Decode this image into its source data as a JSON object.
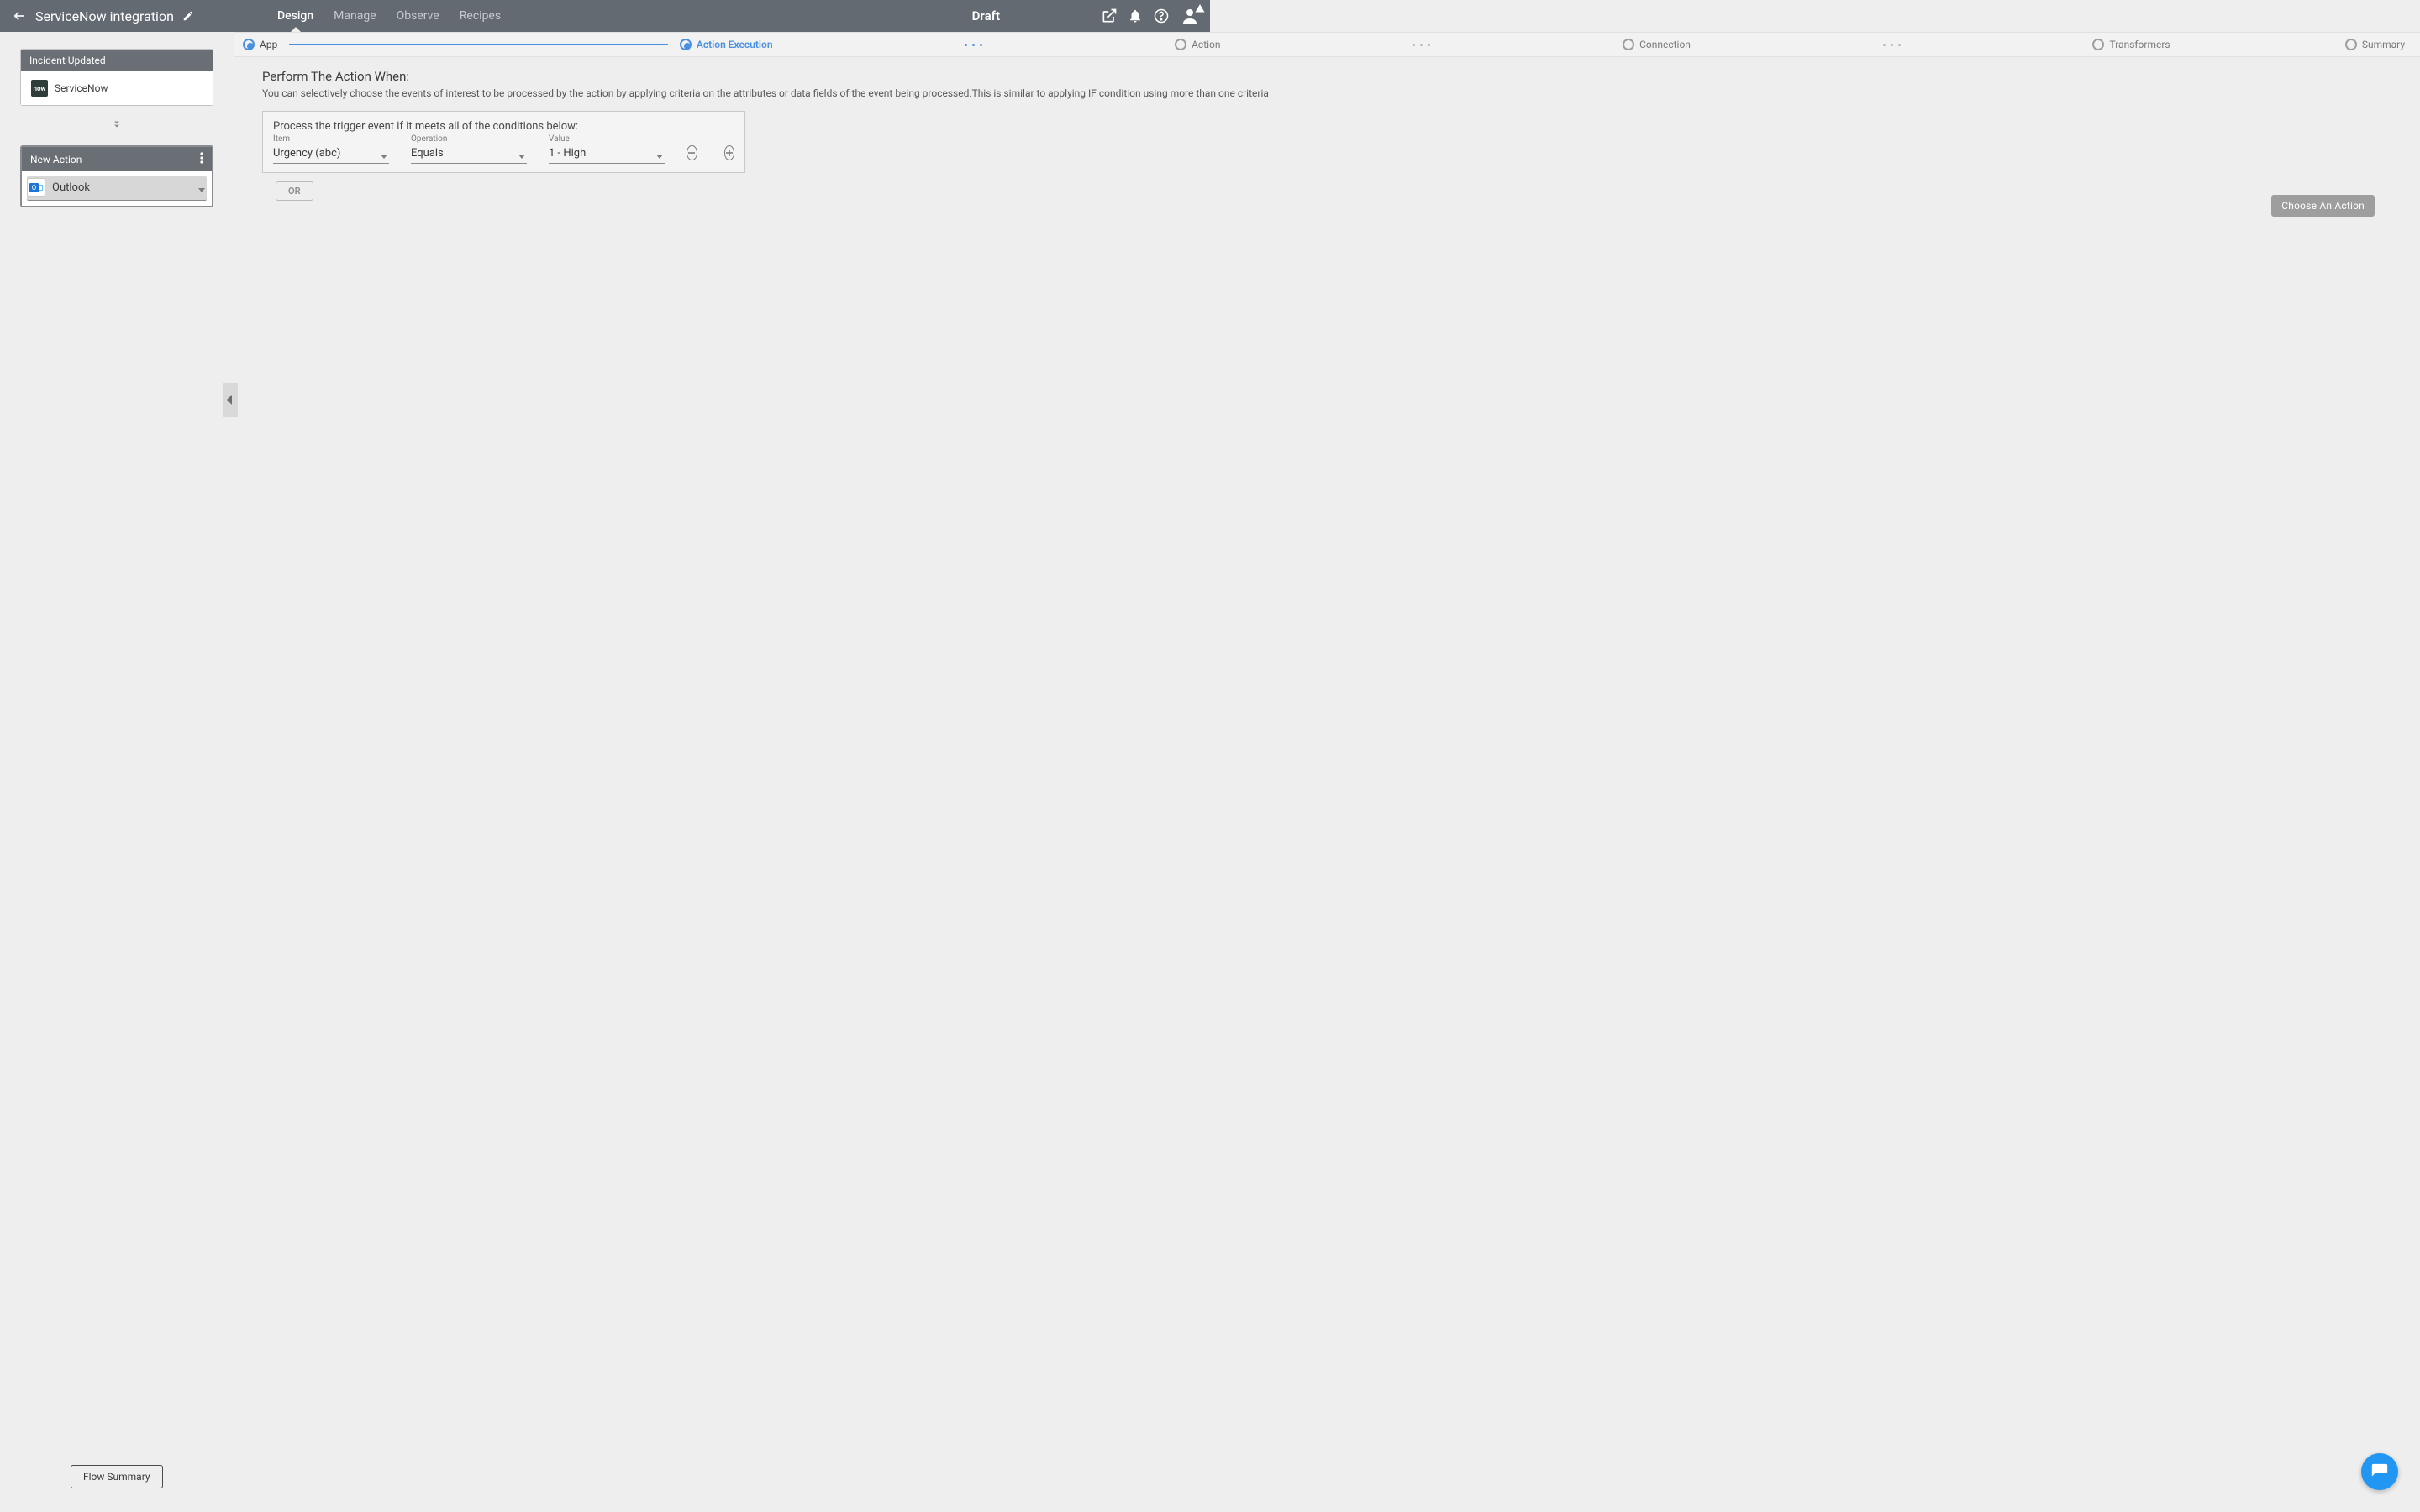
{
  "header": {
    "title": "ServiceNow integration",
    "tabs": [
      "Design",
      "Manage",
      "Observe",
      "Recipes"
    ],
    "active_tab": 0,
    "status": "Draft"
  },
  "steps": [
    {
      "label": "App",
      "state": "done"
    },
    {
      "label": "Action Execution",
      "state": "active"
    },
    {
      "label": "Action",
      "state": "pending"
    },
    {
      "label": "Connection",
      "state": "pending"
    },
    {
      "label": "Transformers",
      "state": "pending"
    },
    {
      "label": "Summary",
      "state": "pending"
    }
  ],
  "sidebar": {
    "trigger_card": {
      "title": "Incident Updated",
      "app_label": "ServiceNow",
      "icon_text": "now"
    },
    "action_card": {
      "title": "New Action",
      "app_label": "Outlook"
    },
    "footer_button": "Flow Summary"
  },
  "main": {
    "heading": "Perform The Action When:",
    "description": "You can selectively choose the events of interest to be processed by the action by applying criteria on the attributes or data fields of the event being processed.This is similar to applying IF condition using more than one criteria",
    "condition_lead": "Process the trigger event if it meets all of the conditions below:",
    "condition": {
      "item_label": "Item",
      "item_value": "Urgency (abc)",
      "operation_label": "Operation",
      "operation_value": "Equals",
      "value_label": "Value",
      "value_value": "1 - High"
    },
    "or_label": "OR",
    "choose_action_label": "Choose An Action"
  }
}
